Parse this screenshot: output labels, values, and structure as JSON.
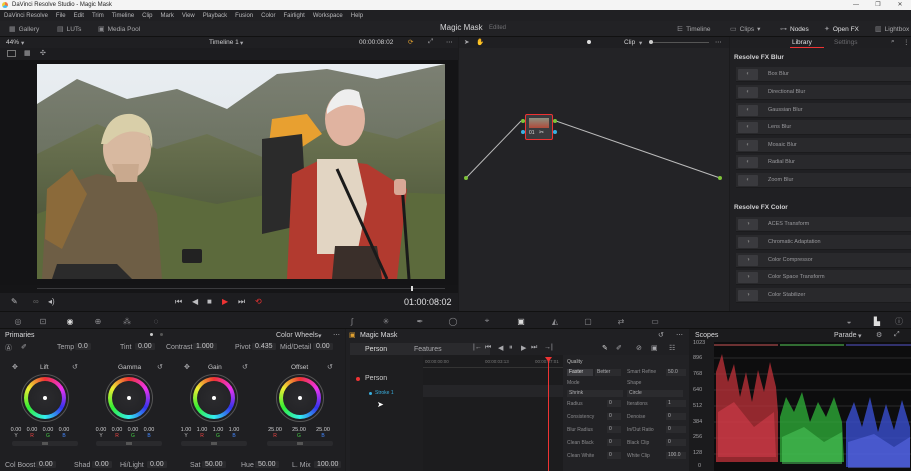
{
  "window": {
    "title": "DaVinci Resolve Studio - Magic Mask",
    "buttons": [
      "—",
      "❐",
      "✕"
    ]
  },
  "menu": [
    "DaVinci Resolve",
    "File",
    "Edit",
    "Trim",
    "Timeline",
    "Clip",
    "Mark",
    "View",
    "Playback",
    "Fusion",
    "Color",
    "Fairlight",
    "Workspace",
    "Help"
  ],
  "toolbar": {
    "gallery": "Gallery",
    "luts": "LUTs",
    "media_pool": "Media Pool",
    "page_title": "Magic Mask",
    "status": "Edited",
    "timeline": "Timeline",
    "clips": "Clips",
    "nodes": "Nodes",
    "openfx": "Open FX",
    "lightbox": "Lightbox"
  },
  "viewer": {
    "zoom": "44%",
    "timeline_name": "Timeline 1",
    "timecode_top": "00:00:08:02",
    "timecode": "01:00:08:02"
  },
  "node_editor": {
    "clip_label": "Clip",
    "node_label": "01"
  },
  "library": {
    "tab_library": "Library",
    "tab_settings": "Settings",
    "sections": [
      {
        "title": "Resolve FX Blur",
        "items": [
          "Box Blur",
          "Directional Blur",
          "Gaussian Blur",
          "Lens Blur",
          "Mosaic Blur",
          "Radial Blur",
          "Zoom Blur"
        ]
      },
      {
        "title": "Resolve FX Color",
        "items": [
          "ACES Transform",
          "Chromatic Adaptation",
          "Color Compressor",
          "Color Space Transform",
          "Color Stabilizer"
        ]
      }
    ]
  },
  "primaries": {
    "title": "Primaries",
    "mode": "Color Wheels",
    "temp_label": "Temp",
    "temp": "0.0",
    "tint_label": "Tint",
    "tint": "0.00",
    "contrast_label": "Contrast",
    "contrast": "1.000",
    "pivot_label": "Pivot",
    "pivot": "0.435",
    "middetail_label": "Mid/Detail",
    "middetail": "0.00",
    "wheels": [
      {
        "name": "Lift",
        "values": [
          "0.00",
          "0.00",
          "0.00",
          "0.00"
        ]
      },
      {
        "name": "Gamma",
        "values": [
          "0.00",
          "0.00",
          "0.00",
          "0.00"
        ]
      },
      {
        "name": "Gain",
        "values": [
          "1.00",
          "1.00",
          "1.00",
          "1.00"
        ]
      },
      {
        "name": "Offset",
        "values": [
          "25.00",
          "25.00",
          "25.00"
        ]
      }
    ],
    "channels": [
      "Y",
      "R",
      "G",
      "B"
    ],
    "bottom": {
      "colboost_label": "Col Boost",
      "colboost": "0.00",
      "shad_label": "Shad",
      "shad": "0.00",
      "hilight_label": "Hi/Light",
      "hilight": "0.00",
      "sat_label": "Sat",
      "sat": "50.00",
      "hue_label": "Hue",
      "hue": "50.00",
      "lmix_label": "L. Mix",
      "lmix": "100.00"
    }
  },
  "magic_mask": {
    "title": "Magic Mask",
    "tab_person": "Person",
    "tab_features": "Features",
    "ruler": [
      "00:00:00:00",
      "00:00:03:13",
      "00:00:07:01"
    ],
    "tracks": [
      {
        "name": "Person"
      },
      {
        "name": "Stroke 1"
      }
    ],
    "quality_label": "Quality",
    "faster": "Faster",
    "better": "Better",
    "smart_refine_label": "Smart Refine",
    "smart_refine": "50.0",
    "mode_label": "Mode",
    "mode": "Shrink",
    "shape_label": "Shape",
    "shape": "Circle",
    "props_left": [
      {
        "label": "Radius",
        "value": "0"
      },
      {
        "label": "Consistency",
        "value": "0"
      },
      {
        "label": "Blur Radius",
        "value": "0"
      },
      {
        "label": "Clean Black",
        "value": "0"
      },
      {
        "label": "Clean White",
        "value": "0"
      }
    ],
    "props_right": [
      {
        "label": "Iterations",
        "value": "1"
      },
      {
        "label": "Denoise",
        "value": "0"
      },
      {
        "label": "In/Out Ratio",
        "value": "0"
      },
      {
        "label": "Black Clip",
        "value": "0"
      },
      {
        "label": "White Clip",
        "value": "100.0"
      }
    ]
  },
  "scopes": {
    "title": "Scopes",
    "mode": "Parade",
    "axis": [
      "1023",
      "896",
      "768",
      "640",
      "512",
      "384",
      "256",
      "128",
      "0"
    ]
  }
}
